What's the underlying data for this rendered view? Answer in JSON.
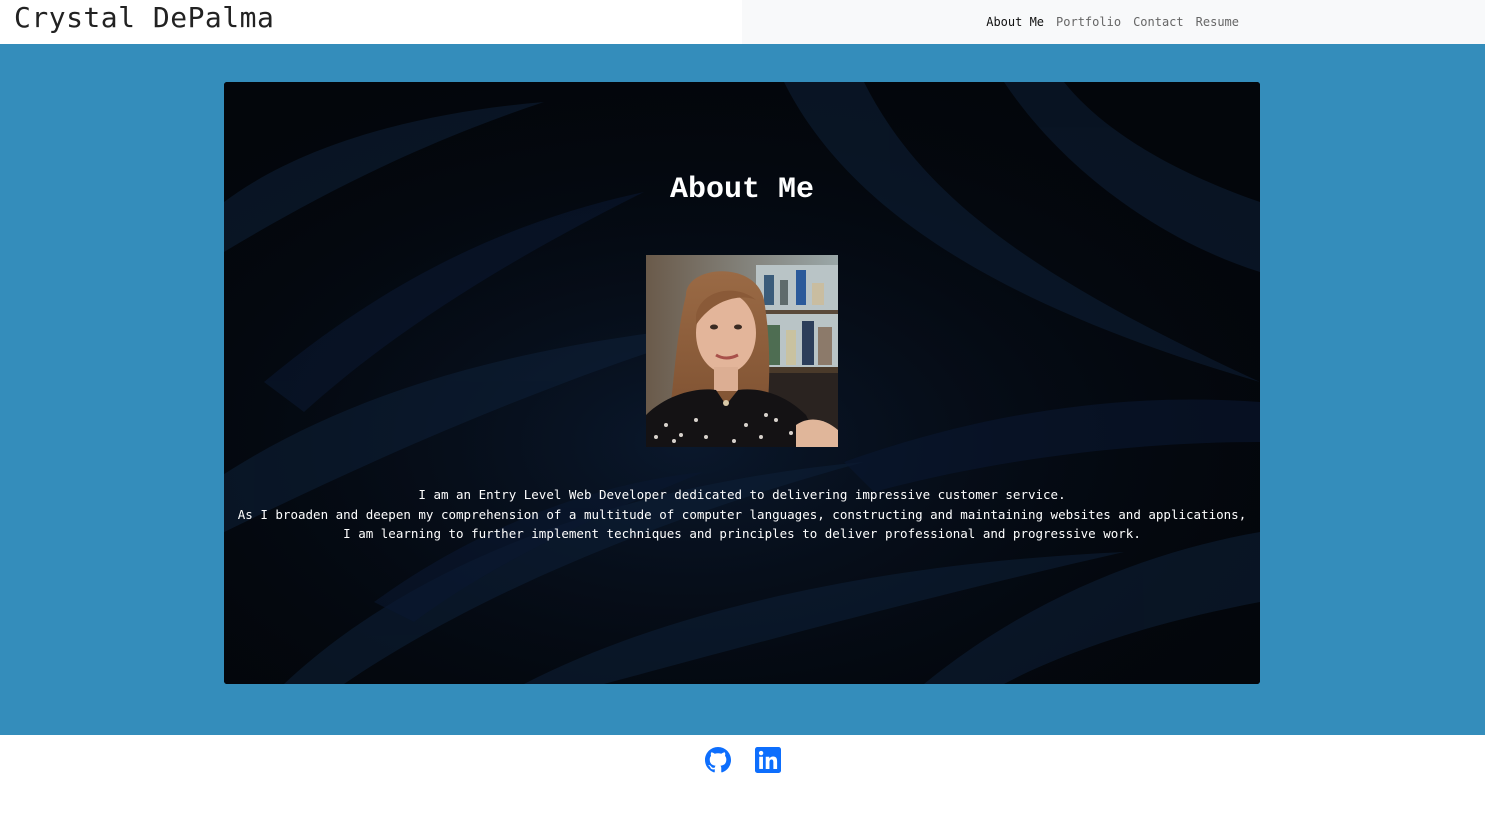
{
  "header": {
    "brand": "Crystal DePalma",
    "nav": [
      {
        "label": "About Me",
        "active": true
      },
      {
        "label": "Portfolio",
        "active": false
      },
      {
        "label": "Contact",
        "active": false
      },
      {
        "label": "Resume",
        "active": false
      }
    ]
  },
  "about": {
    "title": "About Me",
    "photo_icon": "profile-photo",
    "bio_lines": [
      "I am an Entry Level Web Developer dedicated to delivering impressive customer service.",
      "As I broaden and deepen my comprehension of a multitude of computer languages, constructing and maintaining websites and applications,",
      "I am learning to further implement techniques and principles to deliver professional and progressive work."
    ]
  },
  "footer": {
    "links": [
      {
        "icon": "github-icon"
      },
      {
        "icon": "linkedin-icon"
      }
    ]
  },
  "colors": {
    "main_bg": "#348dbb",
    "card_bg": "#03060b",
    "nav_bg": "#f8f9fa",
    "icon_blue": "#0d6efd"
  }
}
